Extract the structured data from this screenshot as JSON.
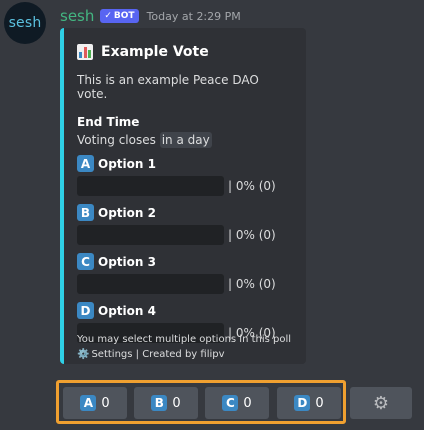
{
  "author": {
    "avatar_text": "sesh",
    "username": "sesh",
    "bot_tag": "BOT",
    "timestamp": "Today at 2:29 PM"
  },
  "embed": {
    "accent_color": "#2fd0e6",
    "title_icon": "bar-chart-icon",
    "title": "Example Vote",
    "description": "This is an example Peace DAO vote.",
    "end_time": {
      "name": "End Time",
      "prefix": "Voting closes",
      "relative": "in a day"
    },
    "options": [
      {
        "letter": "A",
        "label": "Option 1",
        "result": "| 0% (0)",
        "percent": 0
      },
      {
        "letter": "B",
        "label": "Option 2",
        "result": "| 0% (0)",
        "percent": 0
      },
      {
        "letter": "C",
        "label": "Option 3",
        "result": "| 0% (0)",
        "percent": 0
      },
      {
        "letter": "D",
        "label": "Option 4",
        "result": "| 0% (0)",
        "percent": 0
      }
    ],
    "footer_note": "You may select multiple options in this poll",
    "footer_links": "Settings | Created by filipv"
  },
  "buttons": [
    {
      "letter": "A",
      "count": "0"
    },
    {
      "letter": "B",
      "count": "0"
    },
    {
      "letter": "C",
      "count": "0"
    },
    {
      "letter": "D",
      "count": "0"
    }
  ],
  "settings_button_icon": "gear-icon",
  "colors": {
    "letter_badge": "#3b88c3",
    "highlight": "#f0a030",
    "username": "#43b581",
    "bot_tag": "#5865f2"
  }
}
